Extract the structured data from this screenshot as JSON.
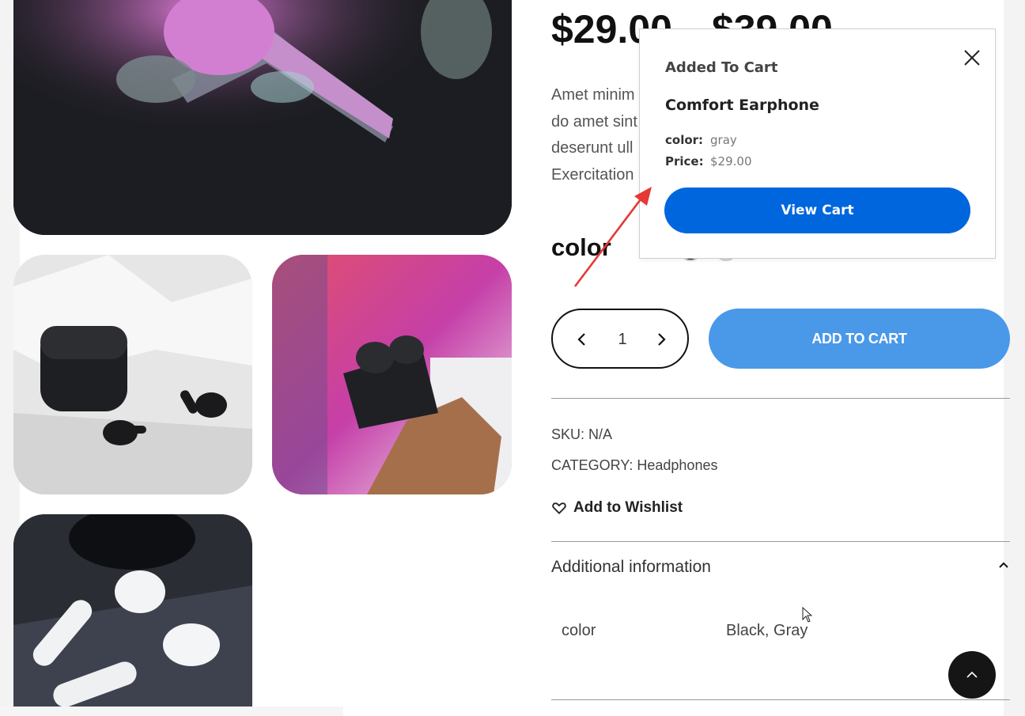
{
  "product": {
    "price_current": "$29.00",
    "price_regular": "$39.00",
    "description_lines": [
      "Amet minim",
      "do amet sint",
      "deserunt ull",
      "Exercitation"
    ],
    "color_label": "color",
    "quantity": "1",
    "add_to_cart_label": "ADD TO CART",
    "sku_text": "SKU: N/A",
    "category_prefix": "CATEGORY: ",
    "category_value": "Headphones",
    "wishlist_label": "Add to Wishlist",
    "swatches": [
      {
        "name": "black",
        "color": "#111111"
      },
      {
        "name": "gray",
        "color": "#dddddd"
      }
    ]
  },
  "additional_info": {
    "title": "Additional information",
    "rows": [
      {
        "name": "color",
        "value": "Black, Gray"
      }
    ]
  },
  "cart_popup": {
    "heading": "Added To Cart",
    "product_name": "Comfort Earphone",
    "color_key": "color:",
    "color_value": "gray",
    "price_key": "Price:",
    "price_value": "$29.00",
    "view_cart_label": "View Cart"
  },
  "colors": {
    "add_to_cart_bg": "#4a98e8",
    "view_cart_bg": "#0066dd",
    "annotation_arrow": "#e53935",
    "scroll_top_bg": "#151515"
  },
  "icons": [
    "chevron-left-icon",
    "chevron-right-icon",
    "heart-icon",
    "chevron-up-icon",
    "close-icon",
    "arrow-up-icon",
    "mouse-cursor-icon"
  ]
}
